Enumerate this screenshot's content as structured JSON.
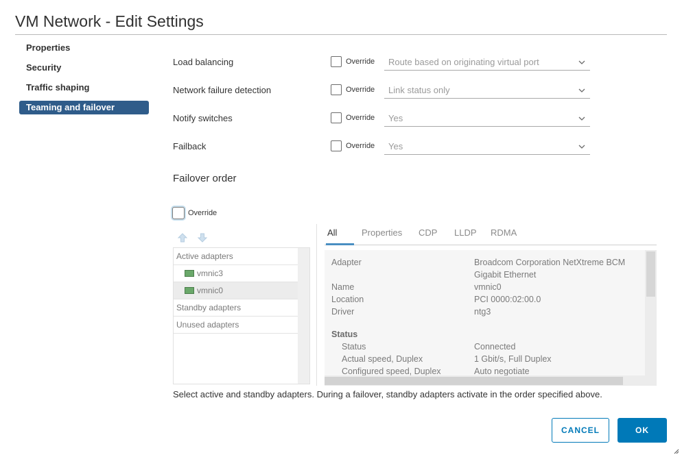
{
  "window": {
    "title": "VM Network - Edit Settings"
  },
  "nav": {
    "items": [
      {
        "label": "Properties",
        "active": false
      },
      {
        "label": "Security",
        "active": false
      },
      {
        "label": "Traffic shaping",
        "active": false
      },
      {
        "label": "Teaming and failover",
        "active": true
      }
    ]
  },
  "settings": {
    "override_label": "Override",
    "rows": [
      {
        "label": "Load balancing",
        "value": "Route based on originating virtual port"
      },
      {
        "label": "Network failure detection",
        "value": "Link status only"
      },
      {
        "label": "Notify switches",
        "value": "Yes"
      },
      {
        "label": "Failback",
        "value": "Yes"
      }
    ]
  },
  "failover": {
    "title": "Failover order",
    "override_label": "Override",
    "groups": [
      {
        "label": "Active adapters"
      },
      {
        "label": "vmnic3"
      },
      {
        "label": "vmnic0"
      },
      {
        "label": "Standby adapters"
      },
      {
        "label": "Unused adapters"
      }
    ],
    "footnote": "Select active and standby adapters. During a failover, standby adapters activate in the order specified above."
  },
  "details": {
    "tabs": [
      "All",
      "Properties",
      "CDP",
      "LLDP",
      "RDMA"
    ],
    "rows": [
      {
        "key": "Adapter",
        "value": "Broadcom Corporation NetXtreme BCM"
      },
      {
        "key": "",
        "value": "Gigabit Ethernet"
      },
      {
        "key": "Name",
        "value": "vmnic0"
      },
      {
        "key": "Location",
        "value": "PCI 0000:02:00.0"
      },
      {
        "key": "Driver",
        "value": "ntg3"
      }
    ],
    "status_heading": "Status",
    "status_rows": [
      {
        "key": "Status",
        "value": "Connected"
      },
      {
        "key": "Actual speed, Duplex",
        "value": "1 Gbit/s, Full Duplex"
      },
      {
        "key": "Configured speed, Duplex",
        "value": "Auto negotiate"
      }
    ]
  },
  "buttons": {
    "cancel": "CANCEL",
    "ok": "OK"
  },
  "colors": {
    "accent": "#0079b8",
    "nav_active": "#2f5c8a",
    "tab_underline": "#4a8ec2"
  }
}
